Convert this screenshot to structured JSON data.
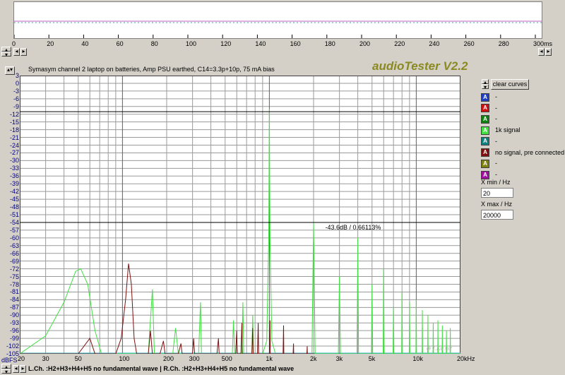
{
  "scope": {
    "ticks": [
      "0",
      "20",
      "40",
      "60",
      "80",
      "100",
      "120",
      "140",
      "160",
      "180",
      "200",
      "220",
      "240",
      "260",
      "280",
      "300ms"
    ]
  },
  "header": {
    "description": "Symasym channel 2 laptop on batteries, Amp PSU earthed, C14=3.3p+10p, 75 mA bias",
    "app_title": "audioTester V2.2"
  },
  "toolbar": {
    "clear_label": "clear curves"
  },
  "legend": [
    {
      "label": "A",
      "text": "-",
      "color": "#2040c0"
    },
    {
      "label": "A",
      "text": "-",
      "color": "#d01010"
    },
    {
      "label": "A",
      "text": "-",
      "color": "#108010"
    },
    {
      "label": "A",
      "text": "1k signal",
      "color": "#40e040"
    },
    {
      "label": "A",
      "text": "-",
      "color": "#108080"
    },
    {
      "label": "A",
      "text": "no signal, pre connected",
      "color": "#801010"
    },
    {
      "label": "A",
      "text": "-",
      "color": "#808010"
    },
    {
      "label": "A",
      "text": "-",
      "color": "#a010a0"
    }
  ],
  "xmin": {
    "label": "X min / Hz",
    "value": "20"
  },
  "xmax": {
    "label": "X max / Hz",
    "value": "20000"
  },
  "status": {
    "text": "L.Ch. :H2+H3+H4+H5 no fundamental wave | R.Ch. :H2+H3+H4+H5 no fundamental wave"
  },
  "chart_data": {
    "type": "line",
    "y_unit": "dBFS",
    "x_unit": "kHz",
    "x_scale": "log",
    "xlim": [
      20,
      20000
    ],
    "ylim": [
      -105,
      3
    ],
    "y_ticks": [
      3,
      0,
      -3,
      -6,
      -9,
      -12,
      -15,
      -18,
      -21,
      -24,
      -27,
      -30,
      -33,
      -36,
      -39,
      -42,
      -45,
      -48,
      -51,
      -54,
      -57,
      -60,
      -63,
      -66,
      -69,
      -72,
      -75,
      -78,
      -81,
      -84,
      -87,
      -90,
      -93,
      -96,
      -99,
      -102,
      -105
    ],
    "x_ticks": [
      {
        "v": 20,
        "t": "20"
      },
      {
        "v": 30,
        "t": "30"
      },
      {
        "v": 50,
        "t": "50"
      },
      {
        "v": 100,
        "t": "100"
      },
      {
        "v": 200,
        "t": "200"
      },
      {
        "v": 300,
        "t": "300"
      },
      {
        "v": 500,
        "t": "500"
      },
      {
        "v": 1000,
        "t": "1k"
      },
      {
        "v": 2000,
        "t": "2k"
      },
      {
        "v": 3000,
        "t": "3k"
      },
      {
        "v": 5000,
        "t": "5k"
      },
      {
        "v": 10000,
        "t": "10k"
      },
      {
        "v": 20000,
        "t": "20kHz"
      }
    ],
    "cursor": {
      "x": 1000,
      "y": -54,
      "label": "-43.6dB  / 0.66113%"
    },
    "top_line_y": -11,
    "series": [
      {
        "name": "1k signal",
        "color": "#40e040",
        "points": [
          [
            20,
            -105
          ],
          [
            30,
            -98
          ],
          [
            40,
            -85
          ],
          [
            48,
            -73
          ],
          [
            52,
            -72
          ],
          [
            58,
            -78
          ],
          [
            65,
            -96
          ],
          [
            72,
            -105
          ],
          [
            150,
            -105
          ],
          [
            160,
            -80
          ],
          [
            165,
            -105
          ],
          [
            220,
            -105
          ],
          [
            230,
            -95
          ],
          [
            240,
            -105
          ],
          [
            330,
            -105
          ],
          [
            340,
            -85
          ],
          [
            345,
            -105
          ],
          [
            560,
            -105
          ],
          [
            570,
            -92
          ],
          [
            580,
            -105
          ],
          [
            650,
            -105
          ],
          [
            660,
            -85
          ],
          [
            670,
            -105
          ],
          [
            760,
            -105
          ],
          [
            770,
            -90
          ],
          [
            780,
            -105
          ],
          [
            900,
            -105
          ],
          [
            960,
            -100
          ],
          [
            990,
            -60
          ],
          [
            1000,
            -10
          ],
          [
            1010,
            -60
          ],
          [
            1040,
            -100
          ],
          [
            1100,
            -105
          ],
          [
            1950,
            -105
          ],
          [
            2000,
            -54
          ],
          [
            2050,
            -105
          ],
          [
            2950,
            -105
          ],
          [
            3000,
            -75
          ],
          [
            3050,
            -105
          ],
          [
            3950,
            -105
          ],
          [
            4000,
            -60
          ],
          [
            4050,
            -105
          ],
          [
            4950,
            -105
          ],
          [
            5000,
            -78
          ],
          [
            5050,
            -105
          ],
          [
            5950,
            -105
          ],
          [
            6000,
            -72
          ],
          [
            6050,
            -105
          ],
          [
            6950,
            -105
          ],
          [
            7000,
            -87
          ],
          [
            7050,
            -105
          ],
          [
            7950,
            -105
          ],
          [
            8000,
            -81
          ],
          [
            8050,
            -105
          ],
          [
            8950,
            -105
          ],
          [
            9000,
            -85
          ],
          [
            9050,
            -105
          ],
          [
            9950,
            -105
          ],
          [
            10000,
            -84
          ],
          [
            10050,
            -105
          ],
          [
            10950,
            -105
          ],
          [
            11000,
            -88
          ],
          [
            11050,
            -105
          ],
          [
            11950,
            -105
          ],
          [
            12000,
            -90
          ],
          [
            12050,
            -105
          ],
          [
            13000,
            -105
          ],
          [
            13050,
            -93
          ],
          [
            13100,
            -105
          ],
          [
            14000,
            -105
          ],
          [
            14050,
            -92
          ],
          [
            14100,
            -105
          ],
          [
            15000,
            -105
          ],
          [
            15050,
            -94
          ],
          [
            15100,
            -105
          ],
          [
            16000,
            -105
          ],
          [
            16050,
            -96
          ],
          [
            16100,
            -105
          ],
          [
            17000,
            -105
          ],
          [
            17050,
            -95
          ],
          [
            17100,
            -105
          ],
          [
            20000,
            -105
          ]
        ]
      },
      {
        "name": "no signal, pre connected",
        "color": "#801010",
        "points": [
          [
            20,
            -105
          ],
          [
            50,
            -105
          ],
          [
            60,
            -99
          ],
          [
            65,
            -105
          ],
          [
            90,
            -105
          ],
          [
            98,
            -99
          ],
          [
            105,
            -84
          ],
          [
            110,
            -70
          ],
          [
            115,
            -78
          ],
          [
            120,
            -99
          ],
          [
            125,
            -105
          ],
          [
            150,
            -105
          ],
          [
            155,
            -96
          ],
          [
            160,
            -105
          ],
          [
            180,
            -105
          ],
          [
            190,
            -100
          ],
          [
            195,
            -105
          ],
          [
            240,
            -105
          ],
          [
            250,
            -101
          ],
          [
            255,
            -105
          ],
          [
            300,
            -105
          ],
          [
            305,
            -99
          ],
          [
            310,
            -105
          ],
          [
            440,
            -105
          ],
          [
            450,
            -99
          ],
          [
            455,
            -105
          ],
          [
            590,
            -105
          ],
          [
            600,
            -96
          ],
          [
            605,
            -105
          ],
          [
            640,
            -105
          ],
          [
            650,
            -93
          ],
          [
            655,
            -105
          ],
          [
            760,
            -105
          ],
          [
            770,
            -95
          ],
          [
            775,
            -105
          ],
          [
            830,
            -105
          ],
          [
            840,
            -93
          ],
          [
            845,
            -105
          ],
          [
            1000,
            -105
          ],
          [
            1010,
            -92
          ],
          [
            1015,
            -105
          ],
          [
            1240,
            -105
          ],
          [
            1250,
            -94
          ],
          [
            1255,
            -105
          ],
          [
            1450,
            -105
          ],
          [
            1460,
            -101
          ],
          [
            1465,
            -105
          ],
          [
            1800,
            -105
          ],
          [
            1810,
            -102
          ],
          [
            1815,
            -105
          ],
          [
            2000,
            -105
          ]
        ]
      }
    ]
  }
}
